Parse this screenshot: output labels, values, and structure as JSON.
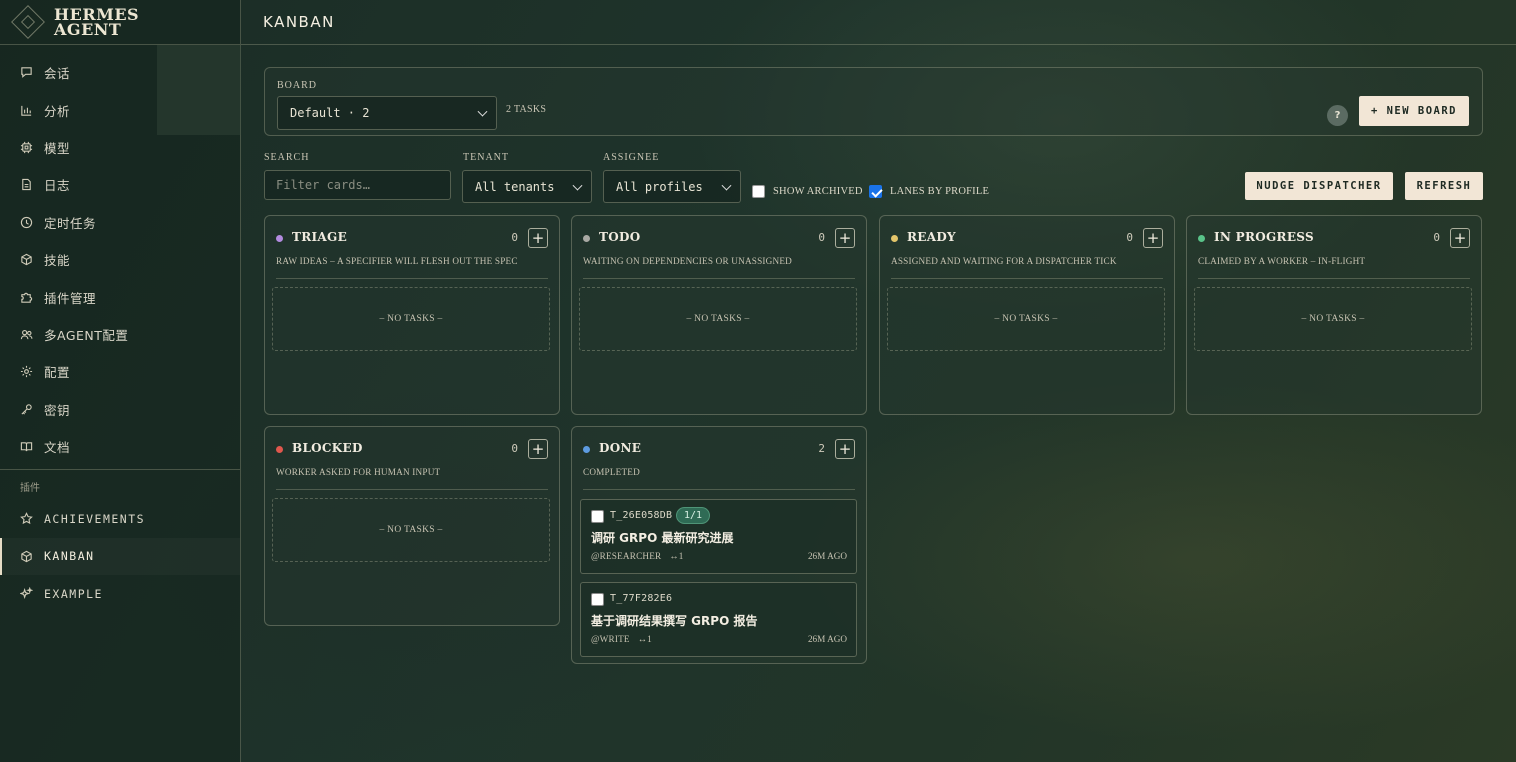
{
  "app": {
    "logo_line1": "HERMES",
    "logo_line2": "AGENT",
    "page_title": "KANBAN"
  },
  "sidebar": {
    "items": [
      {
        "label": "会话",
        "icon": "chat-icon"
      },
      {
        "label": "分析",
        "icon": "chart-icon"
      },
      {
        "label": "模型",
        "icon": "chip-icon"
      },
      {
        "label": "日志",
        "icon": "document-icon"
      },
      {
        "label": "定时任务",
        "icon": "clock-icon"
      },
      {
        "label": "技能",
        "icon": "cube-icon"
      },
      {
        "label": "插件管理",
        "icon": "puzzle-icon"
      },
      {
        "label": "多AGENT配置",
        "icon": "users-icon"
      },
      {
        "label": "配置",
        "icon": "gear-icon"
      },
      {
        "label": "密钥",
        "icon": "key-icon"
      },
      {
        "label": "文档",
        "icon": "book-icon"
      }
    ],
    "plugins_heading": "插件",
    "plugins": [
      {
        "label": "ACHIEVEMENTS",
        "icon": "star-icon"
      },
      {
        "label": "KANBAN",
        "icon": "cube-icon",
        "active": true
      },
      {
        "label": "EXAMPLE",
        "icon": "sparkle-icon"
      }
    ]
  },
  "board": {
    "label": "BOARD",
    "selected": "Default · 2",
    "task_count": "2 TASKS",
    "help": "?",
    "new_board_label": "+ NEW BOARD"
  },
  "filters": {
    "search_label": "SEARCH",
    "search_placeholder": "Filter cards…",
    "tenant_label": "TENANT",
    "tenant_value": "All tenants",
    "assignee_label": "ASSIGNEE",
    "assignee_value": "All profiles",
    "show_archived_label": "SHOW ARCHIVED",
    "show_archived_checked": false,
    "lanes_by_profile_label": "LANES BY PROFILE",
    "lanes_by_profile_checked": true,
    "nudge_label": "NUDGE DISPATCHER",
    "refresh_label": "REFRESH"
  },
  "empty_text": "– NO TASKS –",
  "lanes": [
    {
      "title": "TRIAGE",
      "count": "0",
      "desc": "RAW IDEAS – A SPECIFIER WILL FLESH OUT THE SPEC",
      "color": "#b38be0"
    },
    {
      "title": "TODO",
      "count": "0",
      "desc": "WAITING ON DEPENDENCIES OR UNASSIGNED",
      "color": "#a9a9a4"
    },
    {
      "title": "READY",
      "count": "0",
      "desc": "ASSIGNED AND WAITING FOR A DISPATCHER TICK",
      "color": "#e3c56a"
    },
    {
      "title": "IN PROGRESS",
      "count": "0",
      "desc": "CLAIMED BY A WORKER – IN-FLIGHT",
      "color": "#59c389"
    },
    {
      "title": "BLOCKED",
      "count": "0",
      "desc": "WORKER ASKED FOR HUMAN INPUT",
      "color": "#e0574d"
    },
    {
      "title": "DONE",
      "count": "2",
      "desc": "COMPLETED",
      "color": "#5d9be0"
    }
  ],
  "done_cards": [
    {
      "id": "T_26E058DB",
      "badge": "1/1",
      "title": "调研 GRPO 最新研究进展",
      "assignee": "@RESEARCHER",
      "link": "↔1",
      "age": "26M AGO"
    },
    {
      "id": "T_77F282E6",
      "title": "基于调研结果撰写 GRPO 报告",
      "assignee": "@WRITE",
      "link": "↔1",
      "age": "26M AGO"
    }
  ]
}
